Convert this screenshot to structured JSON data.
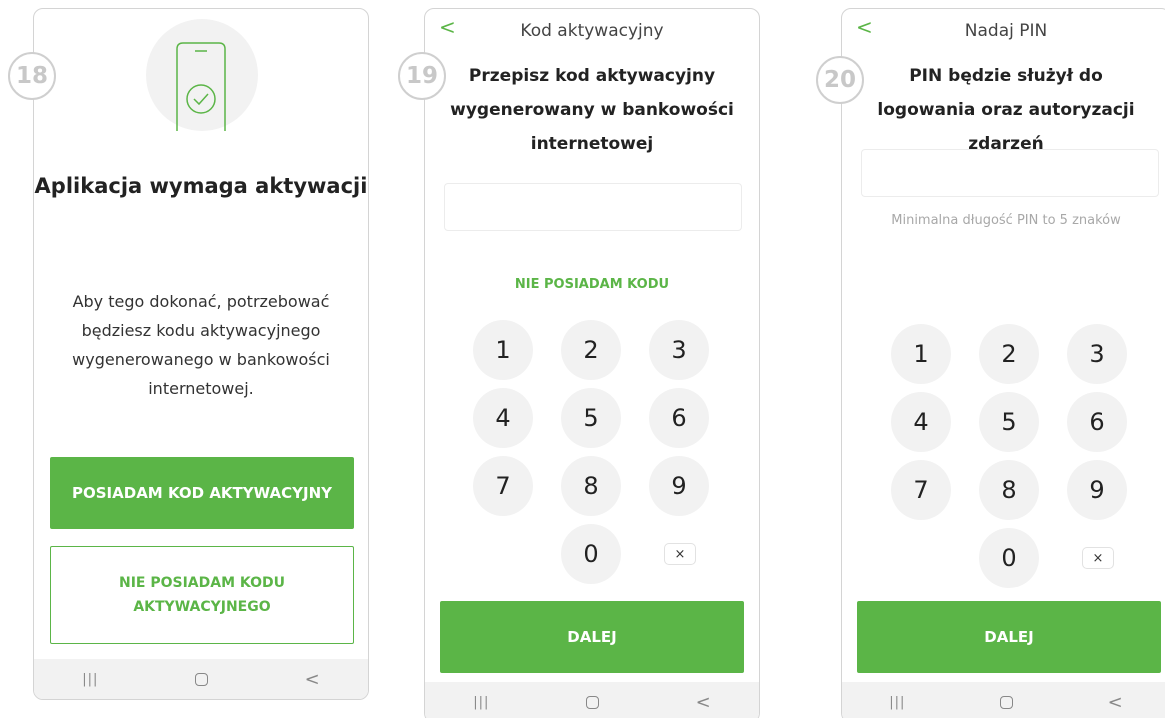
{
  "screen1": {
    "step": "18",
    "title": "Aplikacja wymaga aktywacji",
    "description": "Aby tego dokonać, potrzebować będziesz kodu aktywacyjnego wygenerowanego w bankowości internetowej.",
    "primary_button": "POSIADAM KOD AKTYWACYJNY",
    "secondary_button": "NIE POSIADAM KODU AKTYWACYJNEGO",
    "hero_icon": "phone-check-icon"
  },
  "screen2": {
    "step": "19",
    "header_title": "Kod aktywacyjny",
    "heading": "Przepisz kod aktywacyjny wygenerowany w bankowości internetowej",
    "code_input_value": "",
    "no_code_link": "NIE POSIADAM KODU",
    "next_button": "DALEJ"
  },
  "screen3": {
    "step": "20",
    "header_title": "Nadaj PIN",
    "heading": "PIN będzie służył do logowania oraz autoryzacji zdarzeń",
    "pin_input_value": "",
    "hint": "Minimalna długość PIN to 5 znaków",
    "next_button": "DALEJ"
  },
  "keypad": {
    "k1": "1",
    "k2": "2",
    "k3": "3",
    "k4": "4",
    "k5": "5",
    "k6": "6",
    "k7": "7",
    "k8": "8",
    "k9": "9",
    "k0": "0",
    "delete_icon": "×"
  },
  "common": {
    "back_icon": "<",
    "nav_recent": "|||",
    "nav_back": "<"
  },
  "colors": {
    "accent": "#5bb547",
    "key_bg": "#f2f2f2",
    "badge": "#c8c8c8"
  }
}
